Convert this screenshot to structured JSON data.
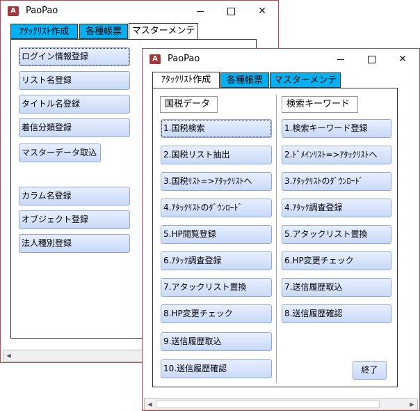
{
  "back_window": {
    "title": "PaoPao",
    "tabs": [
      "ｱﾀｯｸﾘｽﾄ作成",
      "各種帳票",
      "マスターメンテ"
    ],
    "buttons": [
      "ログイン情報登録",
      "リスト名登録",
      "タイトル名登録",
      "着信分類登録",
      "マスターデータ取込",
      "カラム名登録",
      "オブジェクト登録",
      "法人種別登録"
    ]
  },
  "front_window": {
    "title": "PaoPao",
    "tabs": [
      "ｱﾀｯｸﾘｽﾄ作成",
      "各種帳票",
      "マスターメンテ"
    ],
    "left_group_label": "国税データ",
    "left_buttons": [
      "1.国税検索",
      "2.国税リスト抽出",
      "3.国税ﾘｽﾄ=>ｱﾀｯｸﾘｽﾄへ",
      "4.ｱﾀｯｸﾘｽﾄのﾀﾞｳﾝﾛｰﾄﾞ",
      "5.HP閲覧登録",
      "6.ｱﾀｯｸ調査登録",
      "7.アタックリスト置換",
      "8.HP変更チェック",
      "9.送信履歴取込",
      "10.送信履歴確認"
    ],
    "right_group_label": "検索キーワード",
    "right_buttons": [
      "1.検索キーワード登録",
      "2.ﾄﾞﾒｲﾝﾘｽﾄ=>ｱﾀｯｸﾘｽﾄへ",
      "3.ｱﾀｯｸﾘｽﾄのﾀﾞｳﾝﾛｰﾄﾞ",
      "4.ｱﾀｯｸ調査登録",
      "5.アタックリスト置換",
      "6.HP変更チェック",
      "7.送信履歴取込",
      "8.送信履歴確認"
    ],
    "exit_label": "終了"
  },
  "window_controls": {
    "minimize": "—",
    "maximize": "☐",
    "close": "✕"
  },
  "colors": {
    "tab_accent": "#00b0f0",
    "window_border": "#b24a55",
    "button_fill": "#c9d9f7"
  }
}
